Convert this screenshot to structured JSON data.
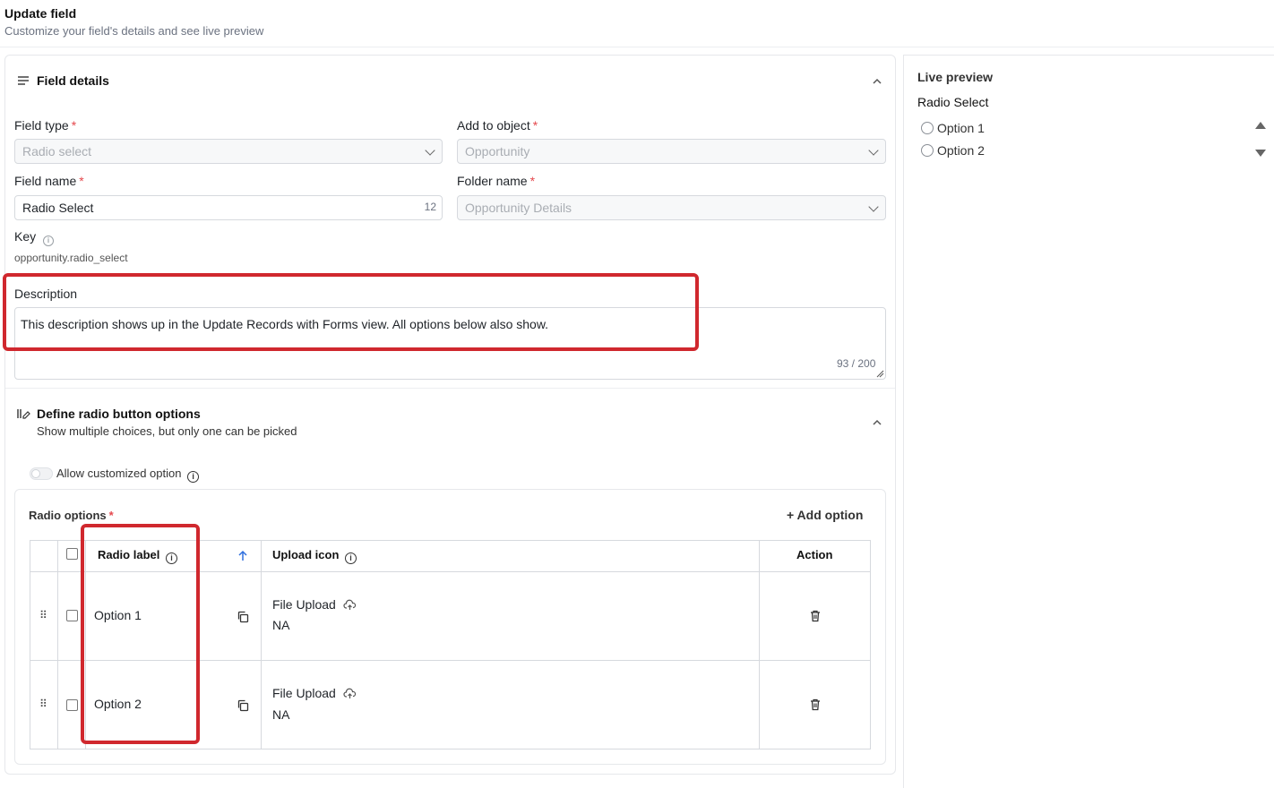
{
  "header": {
    "title": "Update field",
    "subtitle": "Customize your field's details and see live preview"
  },
  "field_details": {
    "title": "Field details",
    "field_type": {
      "label": "Field type",
      "value": "Radio select"
    },
    "add_to_object": {
      "label": "Add to object",
      "value": "Opportunity"
    },
    "field_name": {
      "label": "Field name",
      "value": "Radio Select",
      "count": "12"
    },
    "folder_name": {
      "label": "Folder name",
      "value": "Opportunity Details"
    },
    "key": {
      "label": "Key",
      "value": "opportunity.radio_select"
    },
    "description": {
      "label": "Description",
      "value": "This description shows up in the Update Records with Forms view. All options below also show.",
      "count": "93 / 200"
    },
    "required_mark": "*"
  },
  "radio_section": {
    "title": "Define radio button options",
    "subtitle": "Show multiple choices, but only one can be picked",
    "allow_custom_label": "Allow customized option",
    "options_label": "Radio options",
    "add_option": "+ Add option",
    "columns": {
      "radio_label": "Radio label",
      "upload_icon": "Upload icon",
      "action": "Action"
    },
    "rows": [
      {
        "label": "Option 1",
        "upload": "File Upload",
        "icon_value": "NA"
      },
      {
        "label": "Option 2",
        "upload": "File Upload",
        "icon_value": "NA"
      }
    ]
  },
  "preview": {
    "title": "Live preview",
    "field_label": "Radio Select",
    "options": [
      "Option 1",
      "Option 2"
    ]
  },
  "colors": {
    "highlight": "#d0282e",
    "required": "#e5484d",
    "sort_arrow": "#2f6fde"
  },
  "icons": [
    "lines-icon",
    "chevron-up-icon",
    "chevron-down-icon",
    "info-icon",
    "list-edit-icon",
    "sort-up-icon",
    "copy-icon",
    "cloud-upload-icon",
    "trash-icon",
    "drag-handle-icon"
  ]
}
